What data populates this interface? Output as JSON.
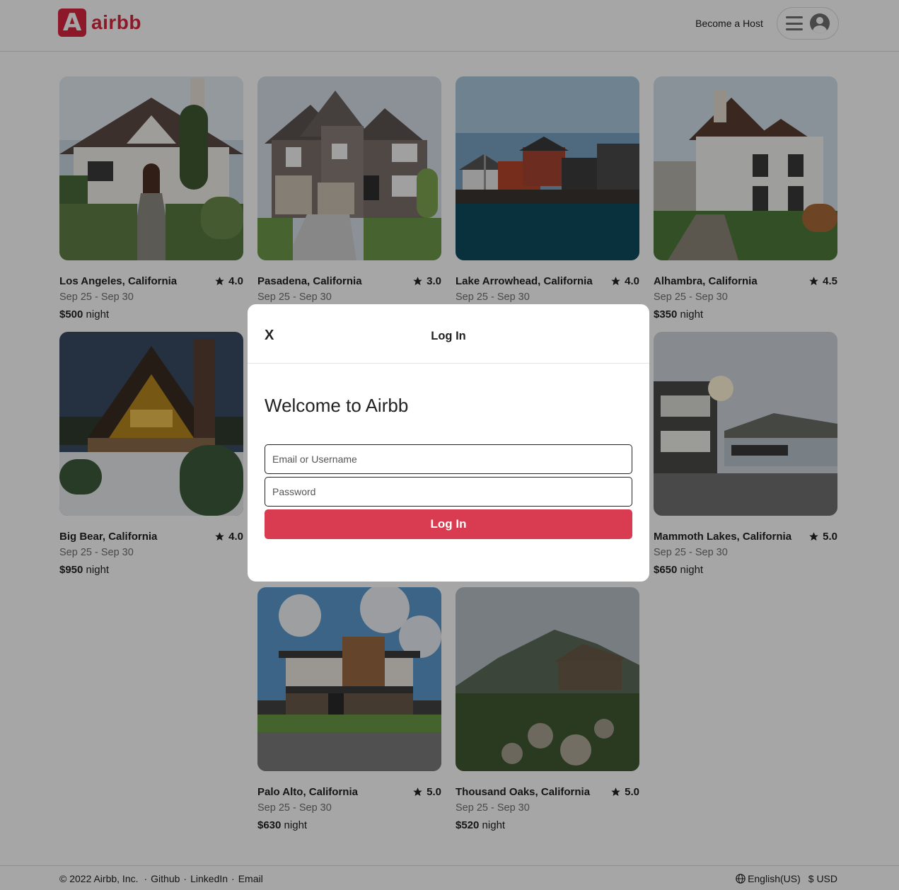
{
  "header": {
    "logo_letter": "A",
    "logo_text": "airbb",
    "host_link": "Become a Host",
    "menu_icon": "hamburger-icon",
    "avatar_icon": "user-avatar-icon"
  },
  "listings": [
    {
      "location": "Los Angeles, California",
      "rating": "4.0",
      "dates": "Sep 25 - Sep 30",
      "price": "$500",
      "unit": "night",
      "scene": "tudor-house"
    },
    {
      "location": "Pasadena, California",
      "rating": "3.0",
      "dates": "Sep 25 - Sep 30",
      "price": "",
      "unit": "",
      "scene": "brick-house"
    },
    {
      "location": "Lake Arrowhead, California",
      "rating": "4.0",
      "dates": "Sep 25 - Sep 30",
      "price": "",
      "unit": "",
      "scene": "lake-houses"
    },
    {
      "location": "Alhambra, California",
      "rating": "4.5",
      "dates": "Sep 25 - Sep 30",
      "price": "$350",
      "unit": "night",
      "scene": "white-villa"
    },
    {
      "location": "Big Bear, California",
      "rating": "4.0",
      "dates": "Sep 25 - Sep 30",
      "price": "$950",
      "unit": "night",
      "scene": "snow-cabin"
    },
    {
      "location": "Mammoth Lakes, California",
      "rating": "5.0",
      "dates": "Sep 25 - Sep 30",
      "price": "$650",
      "unit": "night",
      "scene": "lakeside-house"
    },
    {
      "location": "Palo Alto, California",
      "rating": "5.0",
      "dates": "Sep 25 - Sep 30",
      "price": "$630",
      "unit": "night",
      "scene": "modern-house"
    },
    {
      "location": "Thousand Oaks, California",
      "rating": "5.0",
      "dates": "Sep 25 - Sep 30",
      "price": "$520",
      "unit": "night",
      "scene": "mountain-hut"
    }
  ],
  "footer": {
    "copyright": "© 2022 Airbb, Inc.",
    "links": [
      "Github",
      "LinkedIn",
      "Email"
    ],
    "language": "English(US)",
    "currency": "$ USD"
  },
  "modal": {
    "close_label": "X",
    "title": "Log In",
    "welcome": "Welcome to Airbb",
    "email_placeholder": "Email or Username",
    "password_placeholder": "Password",
    "submit_label": "Log In"
  },
  "colors": {
    "brand": "#d9263f",
    "button": "#d93b51"
  }
}
